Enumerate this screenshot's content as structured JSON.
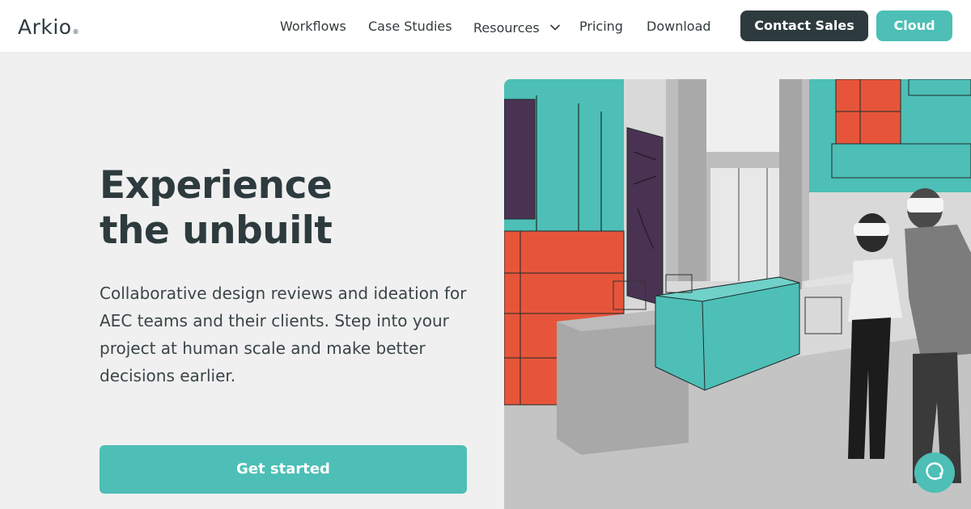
{
  "brand": {
    "name": "Arkio",
    "mark": "®"
  },
  "nav": {
    "items": [
      {
        "label": "Workflows"
      },
      {
        "label": "Case Studies"
      },
      {
        "label": "Resources",
        "has_dropdown": true
      },
      {
        "label": "Pricing"
      },
      {
        "label": "Download"
      }
    ],
    "contact_label": "Contact Sales",
    "cloud_label": "Cloud"
  },
  "hero": {
    "title_line1": "Experience",
    "title_line2": "the unbuilt",
    "description": "Collaborative design reviews and ideation for AEC teams and their clients. Step into your project at human scale and make better decisions earlier.",
    "cta_label": "Get started"
  },
  "icons": {
    "dropdown": "chevron-down-icon",
    "chat": "chat-bubble-icon"
  },
  "colors": {
    "accent": "#4dbfb6",
    "dark": "#2e3b3e",
    "background": "#f0f0f0",
    "orange": "#e6553a",
    "purple": "#4a3352"
  }
}
